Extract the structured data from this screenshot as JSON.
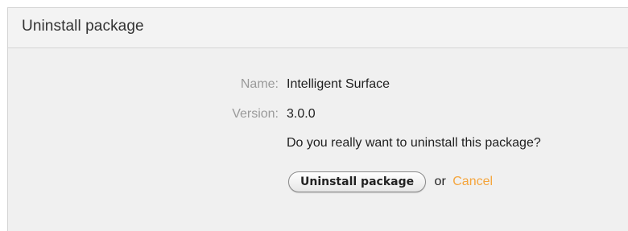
{
  "dialog": {
    "title": "Uninstall package",
    "fields": {
      "name_label": "Name:",
      "name_value": "Intelligent Surface",
      "version_label": "Version:",
      "version_value": "3.0.0"
    },
    "question": "Do you really want to uninstall this package?",
    "actions": {
      "uninstall_label": "Uninstall package",
      "or_text": "or",
      "cancel_label": "Cancel"
    }
  },
  "colors": {
    "cancel_link": "#f5a53c",
    "label_text": "#9a9a9a",
    "body_background": "#f0f0f0"
  }
}
